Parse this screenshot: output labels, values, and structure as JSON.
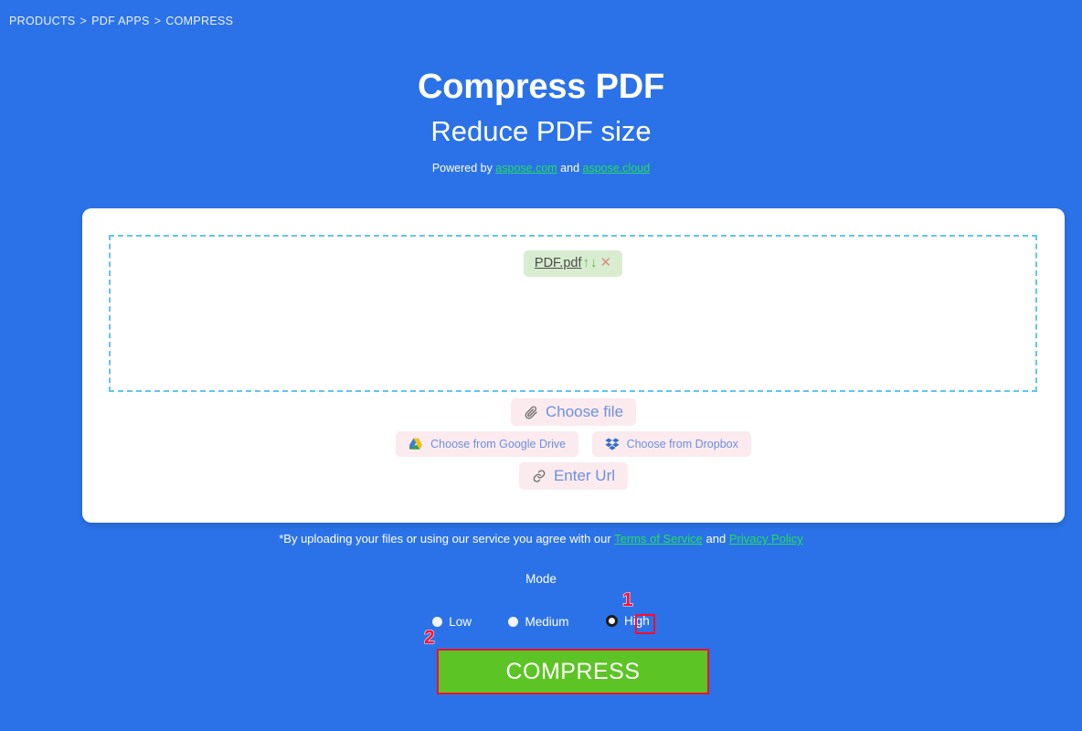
{
  "breadcrumb": {
    "items": [
      "PRODUCTS",
      "PDF APPS",
      "COMPRESS"
    ],
    "separator": ">"
  },
  "hero": {
    "title": "Compress PDF",
    "subtitle": "Reduce PDF size",
    "powered_prefix": "Powered by ",
    "powered_link1": "aspose.com",
    "powered_middle": " and ",
    "powered_link2": "aspose.cloud"
  },
  "dropzone": {
    "file": {
      "name": "PDF.pdf",
      "move_up_icon": "↑",
      "move_down_icon": "↓",
      "remove_icon": "✕"
    }
  },
  "actions": {
    "choose_file": "Choose file",
    "google_drive": "Choose from Google Drive",
    "dropbox": "Choose from Dropbox",
    "enter_url": "Enter Url"
  },
  "terms": {
    "prefix": "*By uploading your files or using our service you agree with our ",
    "link1": "Terms of Service",
    "middle": " and ",
    "link2": "Privacy Policy"
  },
  "mode": {
    "label": "Mode",
    "options": [
      {
        "label": "Low",
        "checked": false
      },
      {
        "label": "Medium",
        "checked": false
      },
      {
        "label": "High",
        "checked": true
      }
    ]
  },
  "submit": {
    "label": "COMPRESS"
  },
  "annotations": [
    {
      "number": "1",
      "target": "high-radio"
    },
    {
      "number": "2",
      "target": "compress-button"
    }
  ],
  "colors": {
    "background": "#2b72e8",
    "card": "#ffffff",
    "dropzone_border": "#62c5ef",
    "link_green": "#21e05a",
    "file_chip_bg": "#d8edd0",
    "pink_button": "#fbebee",
    "pink_button_text": "#6f8ee0",
    "compress_green": "#5dc425",
    "annotation_red": "#ff0d2e"
  }
}
